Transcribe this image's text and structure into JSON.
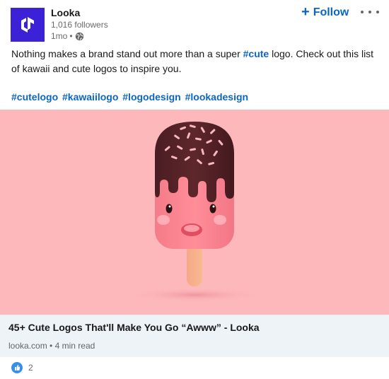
{
  "author": {
    "name": "Looka",
    "followers": "1,016 followers",
    "time": "1mo",
    "visibility_separator": "•",
    "visibility_icon": "globe-icon"
  },
  "actions": {
    "follow_label": "Follow",
    "more_icon": "ellipsis-icon"
  },
  "post": {
    "text_before": "Nothing makes a brand stand out more than a super ",
    "inline_hashtag": "#cute",
    "text_after": " logo. Check out this list of kawaii and cute logos to inspire you.",
    "hashtags": [
      "#cutelogo",
      "#kawaiilogo",
      "#logodesign",
      "#lookadesign"
    ]
  },
  "link_preview": {
    "title": "45+ Cute Logos That'll Make You Go “Awww” - Looka",
    "source": "looka.com",
    "separator": "•",
    "read_time": "4 min read"
  },
  "social": {
    "reaction_icon": "like-icon",
    "reaction_count": "2"
  },
  "colors": {
    "accent": "#0a66c2",
    "brand": "#3b22d6",
    "image_bg": "#fdb8bc",
    "link_bg": "#eef3f8"
  }
}
